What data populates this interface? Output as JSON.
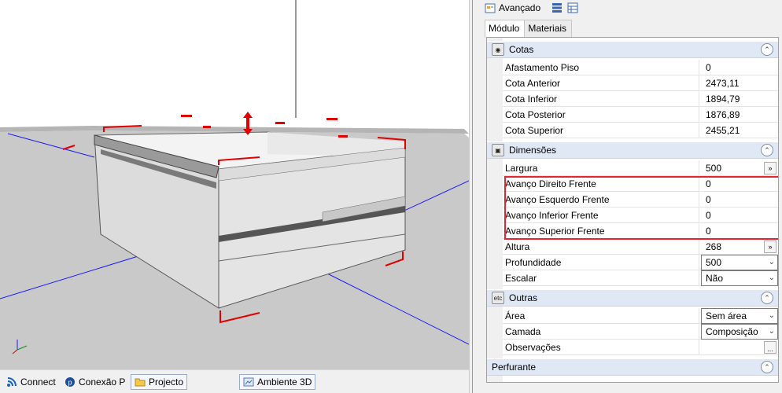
{
  "panel": {
    "title": "Avançado",
    "tabs": [
      {
        "label": "Módulo"
      },
      {
        "label": "Materiais"
      }
    ]
  },
  "categories": {
    "cotas": {
      "label": "Cotas",
      "rows": [
        {
          "name": "Afastamento Piso",
          "value": "0"
        },
        {
          "name": "Cota Anterior",
          "value": "2473,11"
        },
        {
          "name": "Cota Inferior",
          "value": "1894,79"
        },
        {
          "name": "Cota Posterior",
          "value": "1876,89"
        },
        {
          "name": "Cota Superior",
          "value": "2455,21"
        }
      ]
    },
    "dimensoes": {
      "label": "Dimensões",
      "rows": [
        {
          "name": "Largura",
          "value": "500"
        },
        {
          "name": "Avanço Direito Frente",
          "value": "0"
        },
        {
          "name": "Avanço Esquerdo Frente",
          "value": "0"
        },
        {
          "name": "Avanço Inferior Frente",
          "value": "0"
        },
        {
          "name": "Avanço Superior Frente",
          "value": "0"
        },
        {
          "name": "Altura",
          "value": "268"
        },
        {
          "name": "Profundidade",
          "value": "500"
        },
        {
          "name": "Escalar",
          "value": "Não"
        }
      ]
    },
    "outras": {
      "label": "Outras",
      "icon_text": "etc",
      "rows": [
        {
          "name": "Área",
          "value": "Sem área"
        },
        {
          "name": "Camada",
          "value": "Composição"
        },
        {
          "name": "Observações",
          "value": ""
        }
      ]
    },
    "perfurante": {
      "label": "Perfurante"
    }
  },
  "bottombar": {
    "items": [
      {
        "label": "Connect"
      },
      {
        "label": "Conexão P"
      },
      {
        "label": "Projecto"
      },
      {
        "label": "Ambiente 3D"
      }
    ]
  },
  "icons": {
    "more": "»",
    "dots": "...",
    "collapse": "⌃",
    "chevron": "⌄"
  },
  "colors": {
    "highlight": "#e2262f",
    "category_bg": "#dfe8f4",
    "dimension_marker": "#e00000",
    "axis_line": "#0000cc"
  }
}
